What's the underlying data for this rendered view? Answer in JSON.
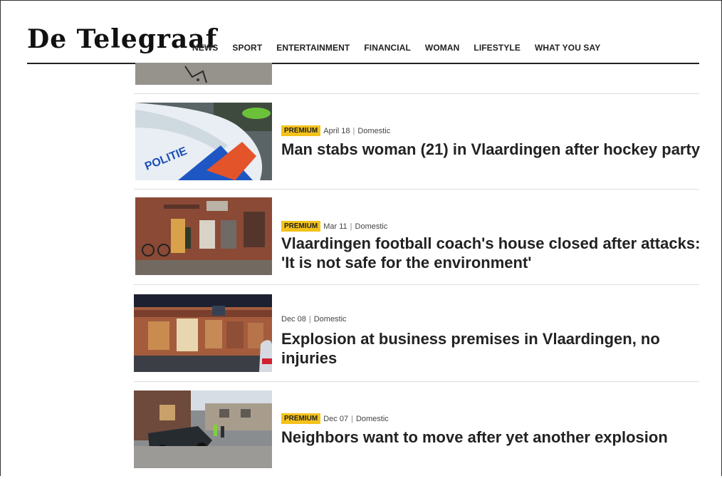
{
  "header": {
    "logo": "De Telegraaf",
    "nav": [
      "NEWS",
      "SPORT",
      "ENTERTAINMENT",
      "FINANCIAL",
      "WOMAN",
      "LIFESTYLE",
      "WHAT YOU SAY"
    ]
  },
  "articles": [
    {
      "premium_label": "PREMIUM",
      "date": "April 18",
      "separator": "|",
      "category": "Domestic",
      "title": "Man stabs woman (21) in Vlaardingen after hockey party",
      "image": "police-car-photo"
    },
    {
      "premium_label": "PREMIUM",
      "date": "Mar 11",
      "separator": "|",
      "category": "Domestic",
      "title": "Vlaardingen football coach's house closed after attacks: 'It is not safe for the environment'",
      "image": "house-entrance-photo"
    },
    {
      "premium_label": "",
      "date": "Dec 08",
      "separator": "|",
      "category": "Domestic",
      "title": "Explosion at business premises in Vlaardingen, no injuries",
      "image": "brick-building-photo"
    },
    {
      "premium_label": "PREMIUM",
      "date": "Dec 07",
      "separator": "|",
      "category": "Domestic",
      "title": "Neighbors want to move after yet another explosion",
      "image": "street-explosion-photo"
    }
  ],
  "colors": {
    "badge": "#f4c21c",
    "text": "#222222"
  }
}
